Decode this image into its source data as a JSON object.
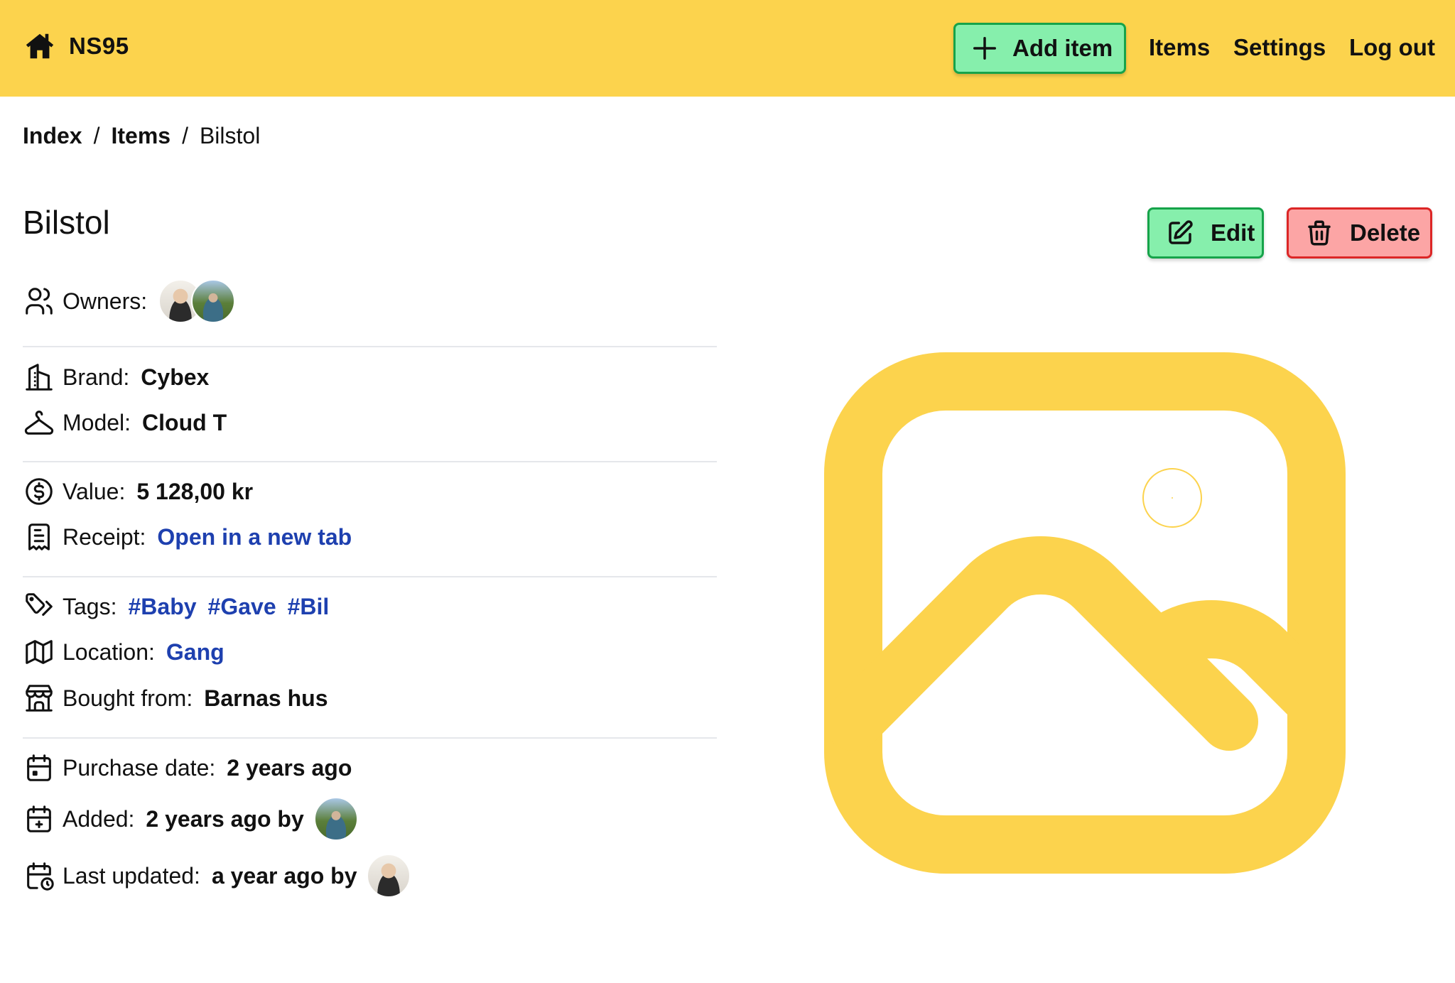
{
  "header": {
    "brand": "NS95",
    "add_item": "Add item",
    "nav": {
      "items": "Items",
      "settings": "Settings",
      "logout": "Log out"
    }
  },
  "breadcrumb": {
    "index": "Index",
    "items": "Items",
    "current": "Bilstol",
    "separator": "/"
  },
  "item": {
    "title": "Bilstol",
    "edit": "Edit",
    "delete": "Delete",
    "owners_label": "Owners:",
    "brand_label": "Brand:",
    "brand": "Cybex",
    "model_label": "Model:",
    "model": "Cloud T",
    "value_label": "Value:",
    "value": "5 128,00 kr",
    "receipt_label": "Receipt:",
    "receipt_link": "Open in a new tab",
    "tags_label": "Tags:",
    "tags": [
      "#Baby",
      "#Gave",
      "#Bil"
    ],
    "location_label": "Location:",
    "location": "Gang",
    "bought_from_label": "Bought from:",
    "bought_from": "Barnas hus",
    "purchase_date_label": "Purchase date:",
    "purchase_date": "2 years ago",
    "added_label": "Added:",
    "added": "2 years ago by",
    "last_updated_label": "Last updated:",
    "last_updated": "a year ago by"
  },
  "colors": {
    "header_bg": "#FCD34D",
    "primary_button": "#86EFAC",
    "danger_button": "#FCA5A5",
    "link": "#1E40AF",
    "placeholder_icon": "#FCD34D"
  },
  "icons": {
    "brand": "home-icon",
    "add": "plus-icon",
    "edit": "pencil-square-icon",
    "delete": "trash-icon",
    "owners": "users-icon",
    "brand_row": "building-icon",
    "model": "hanger-icon",
    "value": "dollar-circle-icon",
    "receipt": "receipt-icon",
    "tags": "tags-icon",
    "location": "map-icon",
    "bought_from": "store-icon",
    "purchase_date": "calendar-icon",
    "added": "calendar-plus-icon",
    "last_updated": "calendar-clock-icon",
    "image": "photo-icon"
  }
}
